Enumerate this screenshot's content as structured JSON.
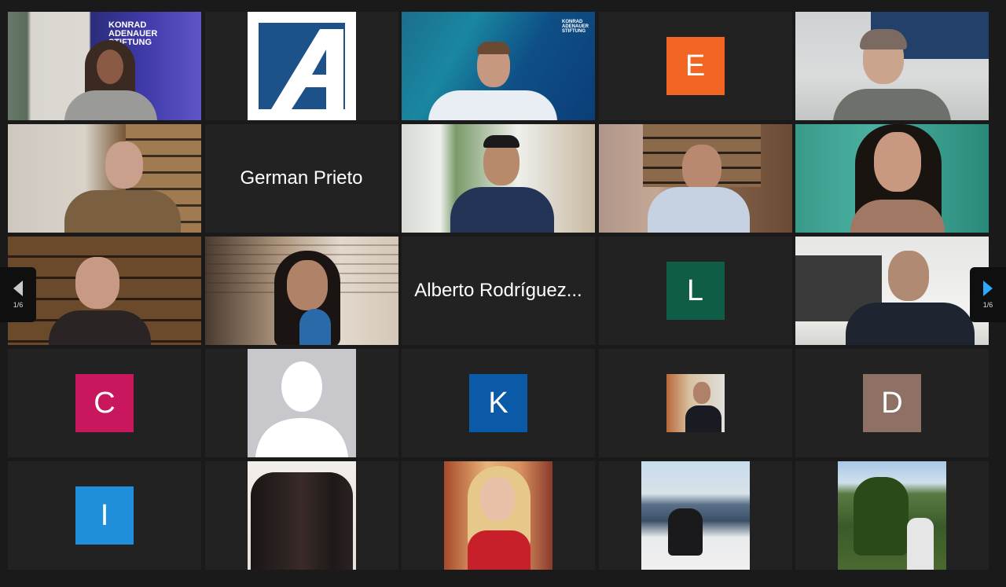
{
  "gallery": {
    "nav_prev": {
      "page": "1/6"
    },
    "nav_next": {
      "page": "1/6"
    },
    "tiles": [
      {
        "kind": "video",
        "name": "participant-1",
        "logo_text": "KONRAD\nADENAUER\nSTIFTUNG"
      },
      {
        "kind": "brand-logo",
        "name": "participant-2"
      },
      {
        "kind": "video",
        "name": "participant-3",
        "logo_text": "KONRAD\nADENAUER\nSTIFTUNG"
      },
      {
        "kind": "letter",
        "name": "participant-4",
        "letter": "E",
        "color": "#f26522"
      },
      {
        "kind": "video",
        "name": "participant-5"
      },
      {
        "kind": "video",
        "name": "participant-6"
      },
      {
        "kind": "name",
        "name": "participant-7",
        "display_name": "German Prieto"
      },
      {
        "kind": "video",
        "name": "participant-8"
      },
      {
        "kind": "video",
        "name": "participant-9-active-speaker"
      },
      {
        "kind": "video",
        "name": "participant-10"
      },
      {
        "kind": "video",
        "name": "participant-11"
      },
      {
        "kind": "video",
        "name": "participant-12"
      },
      {
        "kind": "name",
        "name": "participant-13",
        "display_name": "Alberto Rodríguez..."
      },
      {
        "kind": "letter",
        "name": "participant-14",
        "letter": "L",
        "color": "#0f5c47"
      },
      {
        "kind": "video",
        "name": "participant-15"
      },
      {
        "kind": "letter",
        "name": "participant-16",
        "letter": "C",
        "color": "#c8175d"
      },
      {
        "kind": "profile-pic",
        "name": "participant-17-default-avatar"
      },
      {
        "kind": "letter",
        "name": "participant-18",
        "letter": "K",
        "color": "#0b5aa8"
      },
      {
        "kind": "profile-pic",
        "name": "participant-19"
      },
      {
        "kind": "letter",
        "name": "participant-20",
        "letter": "D",
        "color": "#8f7064"
      },
      {
        "kind": "letter",
        "name": "participant-21",
        "letter": "I",
        "color": "#1f8fdc"
      },
      {
        "kind": "profile-pic",
        "name": "participant-22"
      },
      {
        "kind": "profile-pic",
        "name": "participant-23"
      },
      {
        "kind": "profile-pic",
        "name": "participant-24"
      },
      {
        "kind": "profile-pic",
        "name": "participant-25"
      }
    ]
  }
}
